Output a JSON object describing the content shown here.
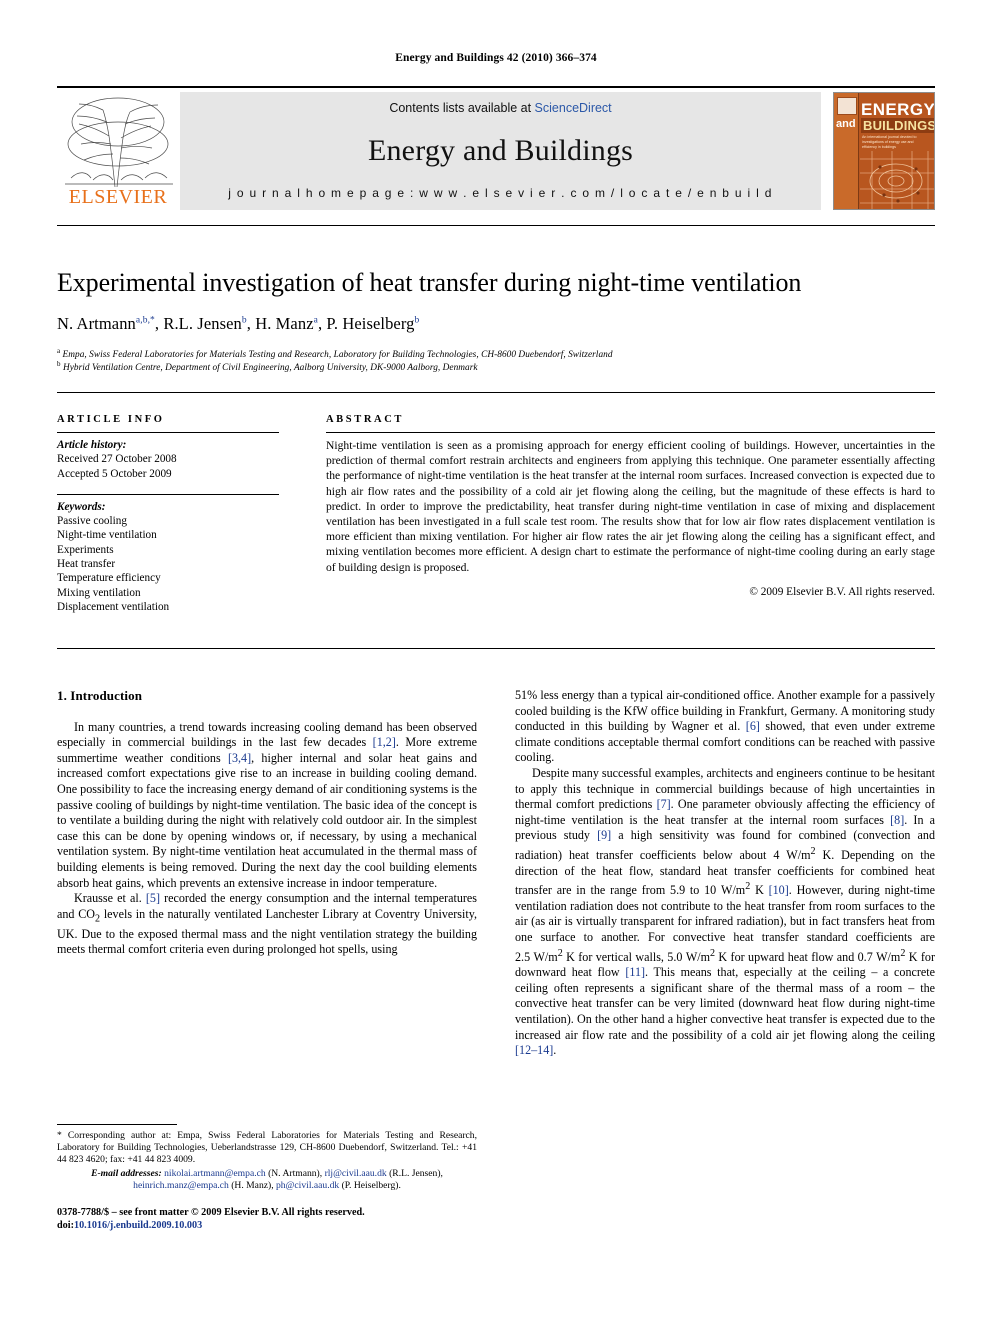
{
  "running_head": "Energy and Buildings 42 (2010) 366–374",
  "masthead": {
    "contents_prefix": "Contents lists available at ",
    "sciencedirect": "ScienceDirect",
    "journal_title": "Energy and Buildings",
    "homepage": "j o u r n a l   h o m e p a g e :   w w w . e l s e v i e r . c o m / l o c a t e / e n b u i l d",
    "publisher": "ELSEVIER",
    "publisher_color": "#e8701a",
    "cover": {
      "energy": "ENERGY",
      "and": "and",
      "buildings": "BUILDINGS",
      "subtitle": "An international journal devoted to investigations of energy use and efficiency in buildings",
      "bg_color": "#b8561f"
    }
  },
  "article": {
    "title": "Experimental investigation of heat transfer during night-time ventilation",
    "authors_html": "N. Artmann <sup>a,b,*</sup>, R.L. Jensen <sup>b</sup>, H. Manz <sup>a</sup>, P. Heiselberg <sup>b</sup>",
    "authors_plain": "N. Artmann a,b,*, R.L. Jensen b, H. Manz a, P. Heiselberg b",
    "affiliation_a": "Empa, Swiss Federal Laboratories for Materials Testing and Research, Laboratory for Building Technologies, CH-8600 Duebendorf, Switzerland",
    "affiliation_b": "Hybrid Ventilation Centre, Department of Civil Engineering, Aalborg University, DK-9000 Aalborg, Denmark"
  },
  "article_info": {
    "heading": "ARTICLE INFO",
    "history_label": "Article history:",
    "received": "Received 27 October 2008",
    "accepted": "Accepted 5 October 2009",
    "keywords_label": "Keywords:",
    "keywords": [
      "Passive cooling",
      "Night-time ventilation",
      "Experiments",
      "Heat transfer",
      "Temperature efficiency",
      "Mixing ventilation",
      "Displacement ventilation"
    ]
  },
  "abstract": {
    "heading": "ABSTRACT",
    "text": "Night-time ventilation is seen as a promising approach for energy efficient cooling of buildings. However, uncertainties in the prediction of thermal comfort restrain architects and engineers from applying this technique. One parameter essentially affecting the performance of night-time ventilation is the heat transfer at the internal room surfaces. Increased convection is expected due to high air flow rates and the possibility of a cold air jet flowing along the ceiling, but the magnitude of these effects is hard to predict. In order to improve the predictability, heat transfer during night-time ventilation in case of mixing and displacement ventilation has been investigated in a full scale test room. The results show that for low air flow rates displacement ventilation is more efficient than mixing ventilation. For higher air flow rates the air jet flowing along the ceiling has a significant effect, and mixing ventilation becomes more efficient. A design chart to estimate the performance of night-time cooling during an early stage of building design is proposed.",
    "copyright": "© 2009 Elsevier B.V. All rights reserved."
  },
  "body": {
    "section_number_title": "1. Introduction",
    "left_paragraphs": [
      "In many countries, a trend towards increasing cooling demand has been observed especially in commercial buildings in the last few decades [1,2]. More extreme summertime weather conditions [3,4], higher internal and solar heat gains and increased comfort expectations give rise to an increase in building cooling demand. One possibility to face the increasing energy demand of air conditioning systems is the passive cooling of buildings by night-time ventilation. The basic idea of the concept is to ventilate a building during the night with relatively cold outdoor air. In the simplest case this can be done by opening windows or, if necessary, by using a mechanical ventilation system. By night-time ventilation heat accumulated in the thermal mass of building elements is being removed. During the next day the cool building elements absorb heat gains, which prevents an extensive increase in indoor temperature.",
      "Krausse et al. [5] recorded the energy consumption and the internal temperatures and CO2 levels in the naturally ventilated Lanchester Library at Coventry University, UK. Due to the exposed thermal mass and the night ventilation strategy the building meets thermal comfort criteria even during prolonged hot spells, using"
    ],
    "right_paragraphs": [
      "51% less energy than a typical air-conditioned office. Another example for a passively cooled building is the KfW office building in Frankfurt, Germany. A monitoring study conducted in this building by Wagner et al. [6] showed, that even under extreme climate conditions acceptable thermal comfort conditions can be reached with passive cooling.",
      "Despite many successful examples, architects and engineers continue to be hesitant to apply this technique in commercial buildings because of high uncertainties in thermal comfort predictions [7]. One parameter obviously affecting the efficiency of night-time ventilation is the heat transfer at the internal room surfaces [8]. In a previous study [9] a high sensitivity was found for combined (convection and radiation) heat transfer coefficients below about 4 W/m2 K. Depending on the direction of the heat flow, standard heat transfer coefficients for combined heat transfer are in the range from 5.9 to 10 W/m2 K [10]. However, during night-time ventilation radiation does not contribute to the heat transfer from room surfaces to the air (as air is virtually transparent for infrared radiation), but in fact transfers heat from one surface to another. For convective heat transfer standard coefficients are 2.5 W/m2 K for vertical walls, 5.0 W/m2 K for upward heat flow and 0.7 W/m2 K for downward heat flow [11]. This means that, especially at the ceiling – a concrete ceiling often represents a significant share of the thermal mass of a room – the convective heat transfer can be very limited (downward heat flow during night-time ventilation). On the other hand a higher convective heat transfer is expected due to the increased air flow rate and the possibility of a cold air jet flowing along the ceiling [12–14]."
    ]
  },
  "footnote": {
    "corresponding": "* Corresponding author at: Empa, Swiss Federal Laboratories for Materials Testing and Research, Laboratory for Building Technologies, Ueberlandstrasse 129, CH-8600 Duebendorf, Switzerland. Tel.: +41 44 823 4620; fax: +41 44 823 4009.",
    "email_label": "E-mail addresses:",
    "emails": [
      {
        "address": "nikolai.artmann@empa.ch",
        "person": "(N. Artmann)"
      },
      {
        "address": "rlj@civil.aau.dk",
        "person": "(R.L. Jensen)"
      },
      {
        "address": "heinrich.manz@empa.ch",
        "person": "(H. Manz)"
      },
      {
        "address": "ph@civil.aau.dk",
        "person": "(P. Heiselberg)"
      }
    ]
  },
  "imprint": {
    "issn_line": "0378-7788/$ – see front matter © 2009 Elsevier B.V. All rights reserved.",
    "doi_label": "doi:",
    "doi_value": "10.1016/j.enbuild.2009.10.003"
  }
}
